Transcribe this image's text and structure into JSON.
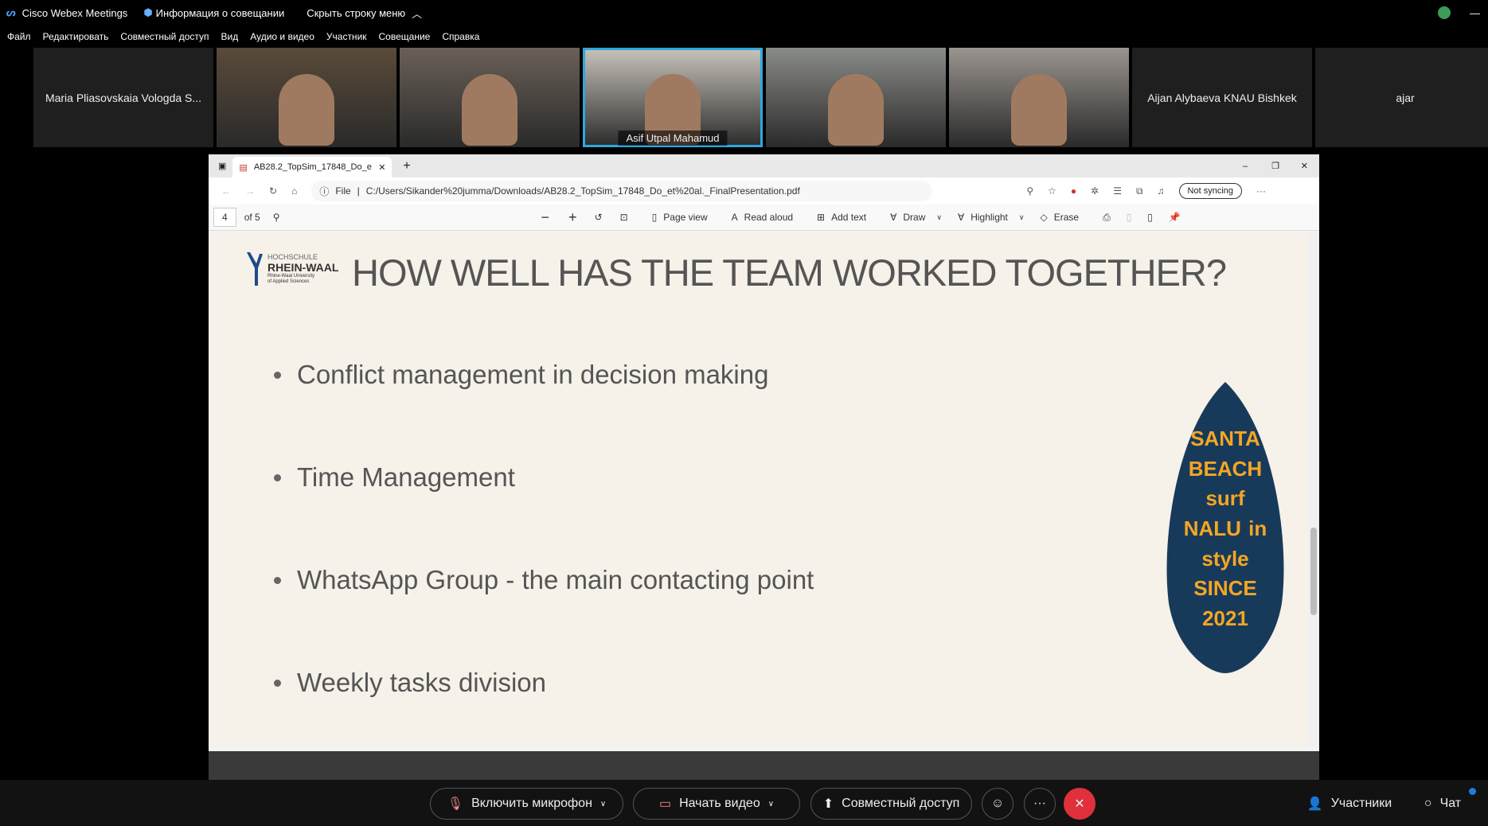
{
  "app": {
    "title": "Cisco Webex Meetings",
    "meeting_info": "Информация о совещании",
    "hide_menu": "Скрыть строку меню"
  },
  "menu": [
    "Файл",
    "Редактировать",
    "Совместный доступ",
    "Вид",
    "Аудио и видео",
    "Участник",
    "Совещание",
    "Справка"
  ],
  "participants": [
    {
      "name": "Maria Pliasovskaia Vologda S...",
      "video": false
    },
    {
      "name": "",
      "video": true
    },
    {
      "name": "",
      "video": true
    },
    {
      "name": "Asif Utpal Mahamud",
      "video": true,
      "active": true
    },
    {
      "name": "",
      "video": true
    },
    {
      "name": "",
      "video": true
    },
    {
      "name": "Aijan Alybaeva KNAU Bishkek",
      "video": false
    },
    {
      "name": "ajar",
      "video": false
    }
  ],
  "browser": {
    "tab_title": "AB28.2_TopSim_17848_Do_et al.",
    "url_prefix": "File",
    "url": "C:/Users/Sikander%20jumma/Downloads/AB28.2_TopSim_17848_Do_et%20al._FinalPresentation.pdf",
    "sync": "Not syncing"
  },
  "pdf": {
    "page": "4",
    "of": "of 5",
    "page_view": "Page view",
    "read_aloud": "Read aloud",
    "add_text": "Add text",
    "draw": "Draw",
    "highlight": "Highlight",
    "erase": "Erase"
  },
  "slide": {
    "logo": "HOCHSCHULE RHEIN-WAAL Rhine-Waal University of Applied Sciences",
    "title": "HOW WELL HAS THE TEAM WORKED TOGETHER?",
    "bullets": [
      "Conflict management in decision making",
      "Time Management",
      "WhatsApp Group - the main contacting point",
      "Weekly tasks division"
    ],
    "surfboard": "SANTA BEACH surf NALU in style SINCE 2021"
  },
  "controls": {
    "mic": "Включить микрофон",
    "video": "Начать видео",
    "share": "Совместный доступ",
    "participants": "Участники",
    "chat": "Чат"
  },
  "colors": {
    "active_speaker": "#2ea7e0",
    "end_call": "#e0303c",
    "board": "#183a5a",
    "nalu": "#f5a623"
  }
}
